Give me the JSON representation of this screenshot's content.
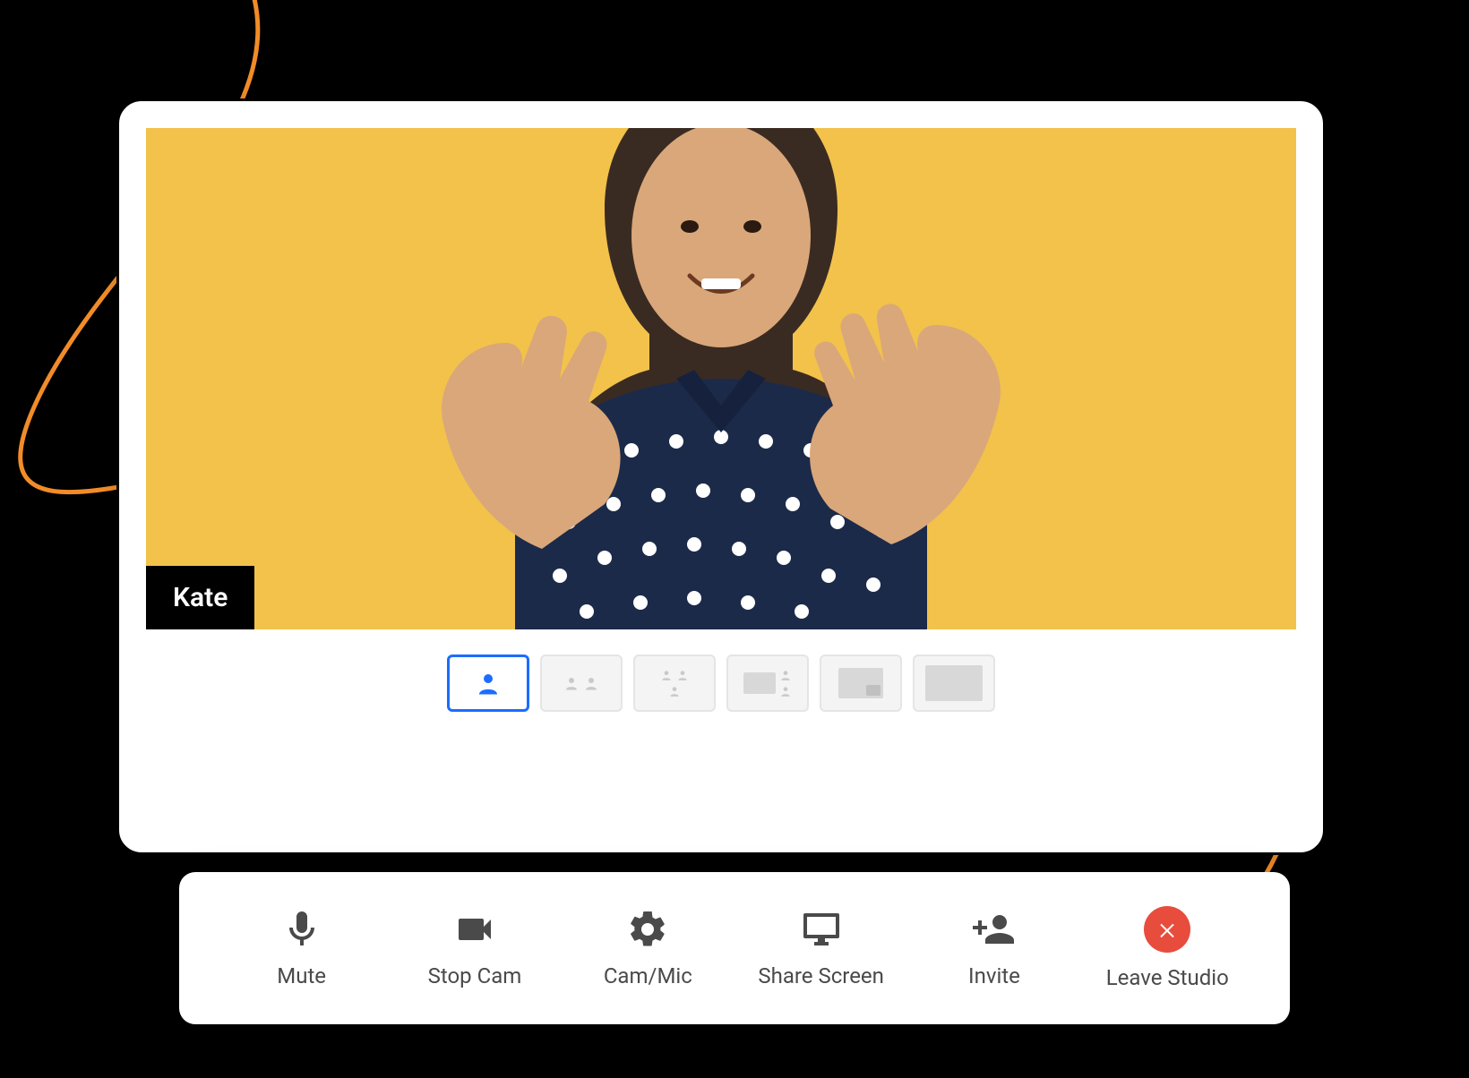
{
  "participant": {
    "name": "Kate"
  },
  "layouts": {
    "items": [
      {
        "name": "single",
        "active": true
      },
      {
        "name": "two-up",
        "active": false
      },
      {
        "name": "three-up",
        "active": false
      },
      {
        "name": "grid-four",
        "active": false
      },
      {
        "name": "screen-pip",
        "active": false
      },
      {
        "name": "screen-only",
        "active": false
      }
    ]
  },
  "toolbar": {
    "mute": "Mute",
    "stop_cam": "Stop Cam",
    "cam_mic": "Cam/Mic",
    "share_screen": "Share Screen",
    "invite": "Invite",
    "leave": "Leave Studio"
  },
  "colors": {
    "video_bg": "#f2c24b",
    "accent": "#1a6dff",
    "danger": "#e84c3d",
    "swirl": "#f28c28"
  },
  "icons": {
    "mute": "microphone-icon",
    "stop_cam": "video-camera-icon",
    "cam_mic": "gear-icon",
    "share_screen": "monitor-icon",
    "invite": "add-person-icon",
    "leave": "close-icon"
  }
}
